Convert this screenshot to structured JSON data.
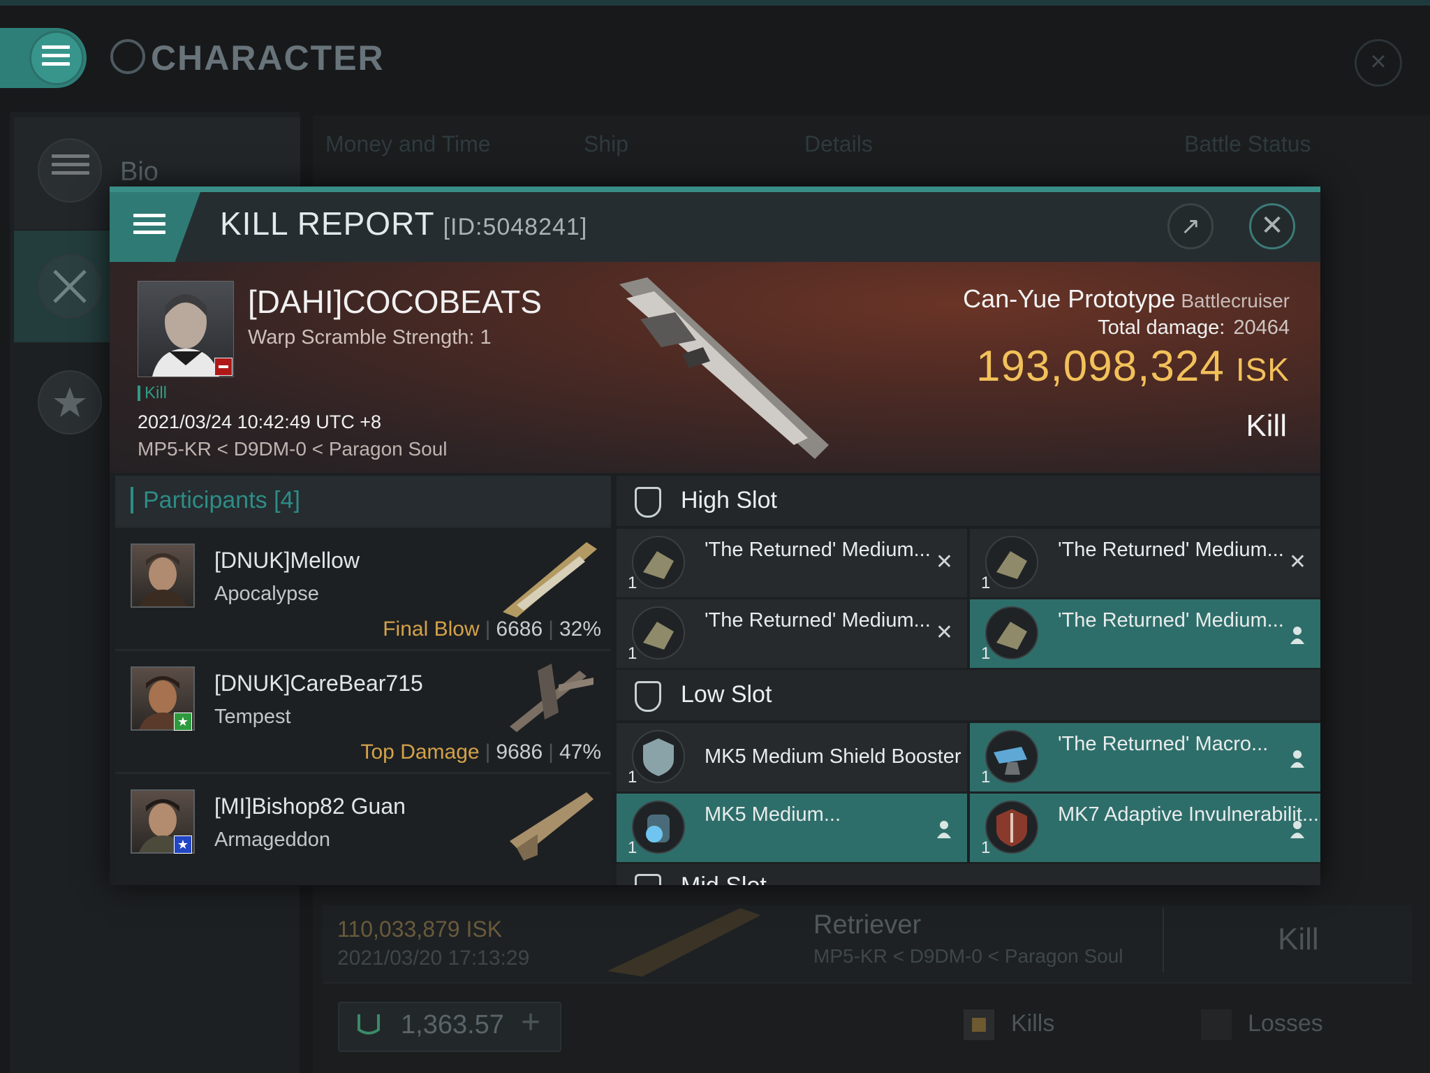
{
  "background": {
    "title": "CHARACTER",
    "sidebar": {
      "bio_label": "Bio"
    },
    "tabs": [
      "Money and Time",
      "Ship",
      "Details",
      "Battle Status"
    ],
    "kill_row": {
      "isk": "110,033,879  ISK",
      "date": "2021/03/20  17:13:29",
      "ship": "Retriever",
      "location": "MP5-KR < D9DM-0 < Paragon Soul",
      "result": "Kill"
    },
    "wallet": {
      "value": "1,363.57",
      "plus": "+"
    },
    "filters": {
      "kills": "Kills",
      "losses": "Losses"
    }
  },
  "modal": {
    "title": "KILL REPORT",
    "report_id": "[ID:5048241]",
    "share_icon": "share-icon",
    "close_icon": "close-icon",
    "victim": {
      "name": "[DAHI]COCOBEATS",
      "info": "Warp Scramble Strength: 1",
      "tag": "Kill",
      "datetime": "2021/03/24 10:42:49 UTC +8",
      "location": "MP5-KR < D9DM-0 < Paragon Soul",
      "ship_name": "Can-Yue Prototype",
      "ship_class": "Battlecruiser",
      "total_damage_label": "Total damage:",
      "total_damage": "20464",
      "isk_value": "193,098,324",
      "isk_unit": "ISK",
      "result": "Kill"
    },
    "participants": {
      "label": "Participants [4]",
      "rows": [
        {
          "name": "[DNUK]Mellow",
          "ship": "Apocalypse",
          "tag": "Final Blow",
          "damage": "6686",
          "percent": "32%"
        },
        {
          "name": "[DNUK]CareBear715",
          "ship": "Tempest",
          "tag": "Top Damage",
          "damage": "9686",
          "percent": "47%"
        },
        {
          "name": "[MI]Bishop82 Guan",
          "ship": "Armageddon"
        }
      ]
    },
    "slots": {
      "high": {
        "label": "High Slot",
        "modules": [
          {
            "name": "'The Returned' Medium...",
            "qty": "1"
          },
          {
            "name": "'The Returned' Medium...",
            "qty": "1"
          },
          {
            "name": "'The Returned' Medium...",
            "qty": "1"
          },
          {
            "name": "'The Returned' Medium...",
            "qty": "1"
          }
        ]
      },
      "low": {
        "label": "Low Slot",
        "modules": [
          {
            "name": "MK5 Medium Shield Booster",
            "qty": "1"
          },
          {
            "name": "'The Returned' Macro...",
            "qty": "1"
          },
          {
            "name": "MK5 Medium...",
            "qty": "1"
          },
          {
            "name": "MK7 Adaptive Invulnerabilit...",
            "qty": "1"
          }
        ]
      },
      "mid_partial": "Mid Slot"
    }
  },
  "colors": {
    "accent": "#2e8c87",
    "isk": "#f2c15a",
    "tag": "#d4a24a",
    "teal_row": "#2e6e6a"
  }
}
